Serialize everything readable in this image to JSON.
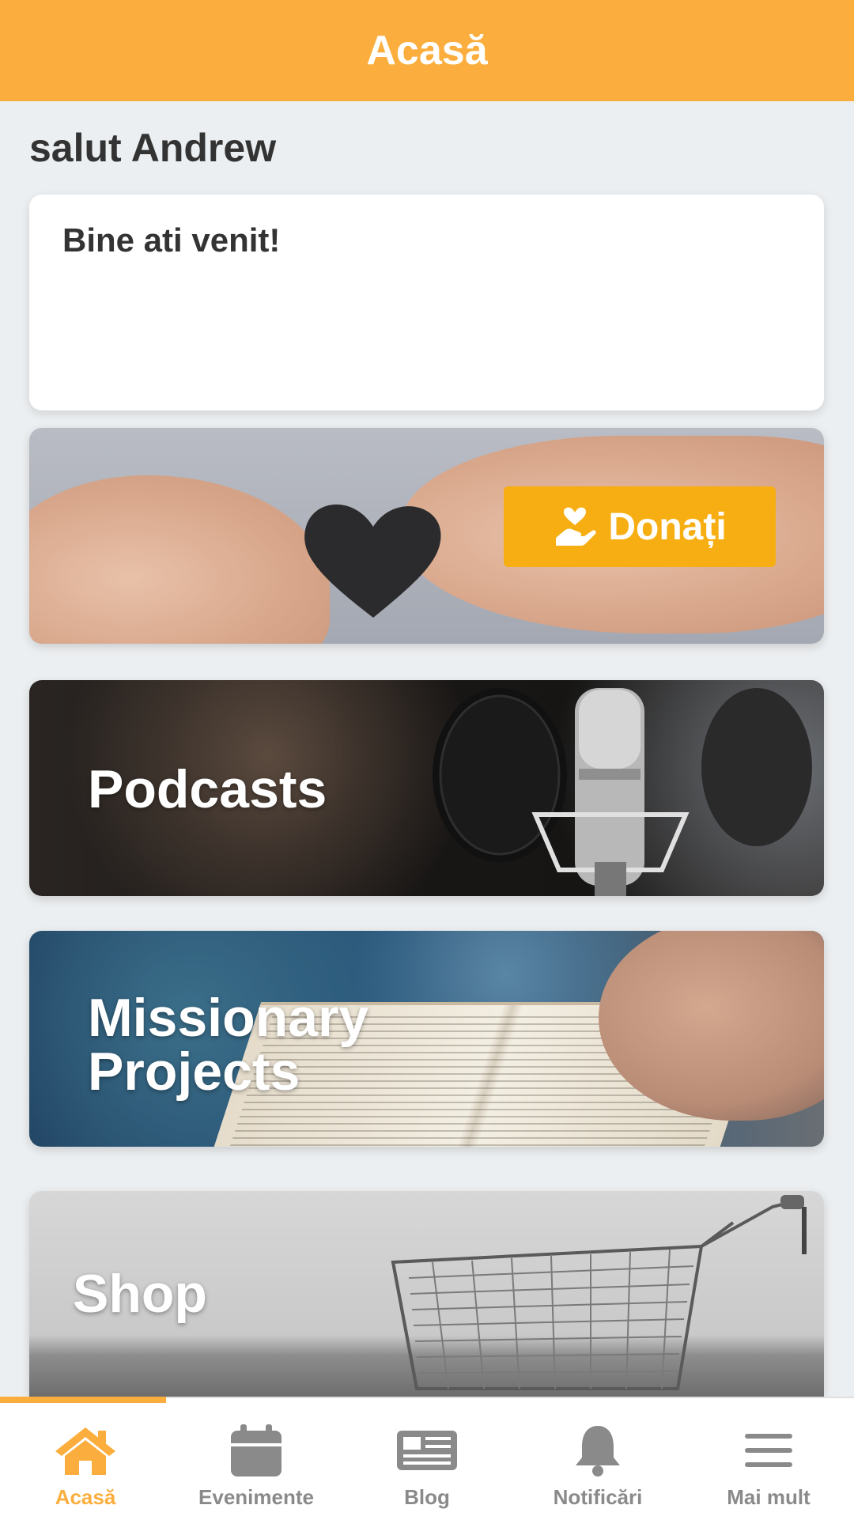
{
  "header": {
    "title": "Acasă"
  },
  "greeting": "salut Andrew",
  "welcome_card": {
    "text": "Bine ati venit!"
  },
  "tiles": {
    "donate": {
      "button_label": "Donați"
    },
    "podcasts": {
      "label": "Podcasts"
    },
    "missionary": {
      "line1": "Missionary",
      "line2": "Projects"
    },
    "shop": {
      "label": "Shop"
    }
  },
  "bottom_nav": {
    "items": [
      {
        "label": "Acasă",
        "icon": "home-icon",
        "active": true
      },
      {
        "label": "Evenimente",
        "icon": "calendar-icon",
        "active": false
      },
      {
        "label": "Blog",
        "icon": "newspaper-icon",
        "active": false
      },
      {
        "label": "Notificări",
        "icon": "bell-icon",
        "active": false
      },
      {
        "label": "Mai mult",
        "icon": "menu-icon",
        "active": false
      }
    ]
  },
  "colors": {
    "accent": "#fbae3d",
    "donate_button": "#f7ae12",
    "inactive": "#8a8a8a"
  }
}
